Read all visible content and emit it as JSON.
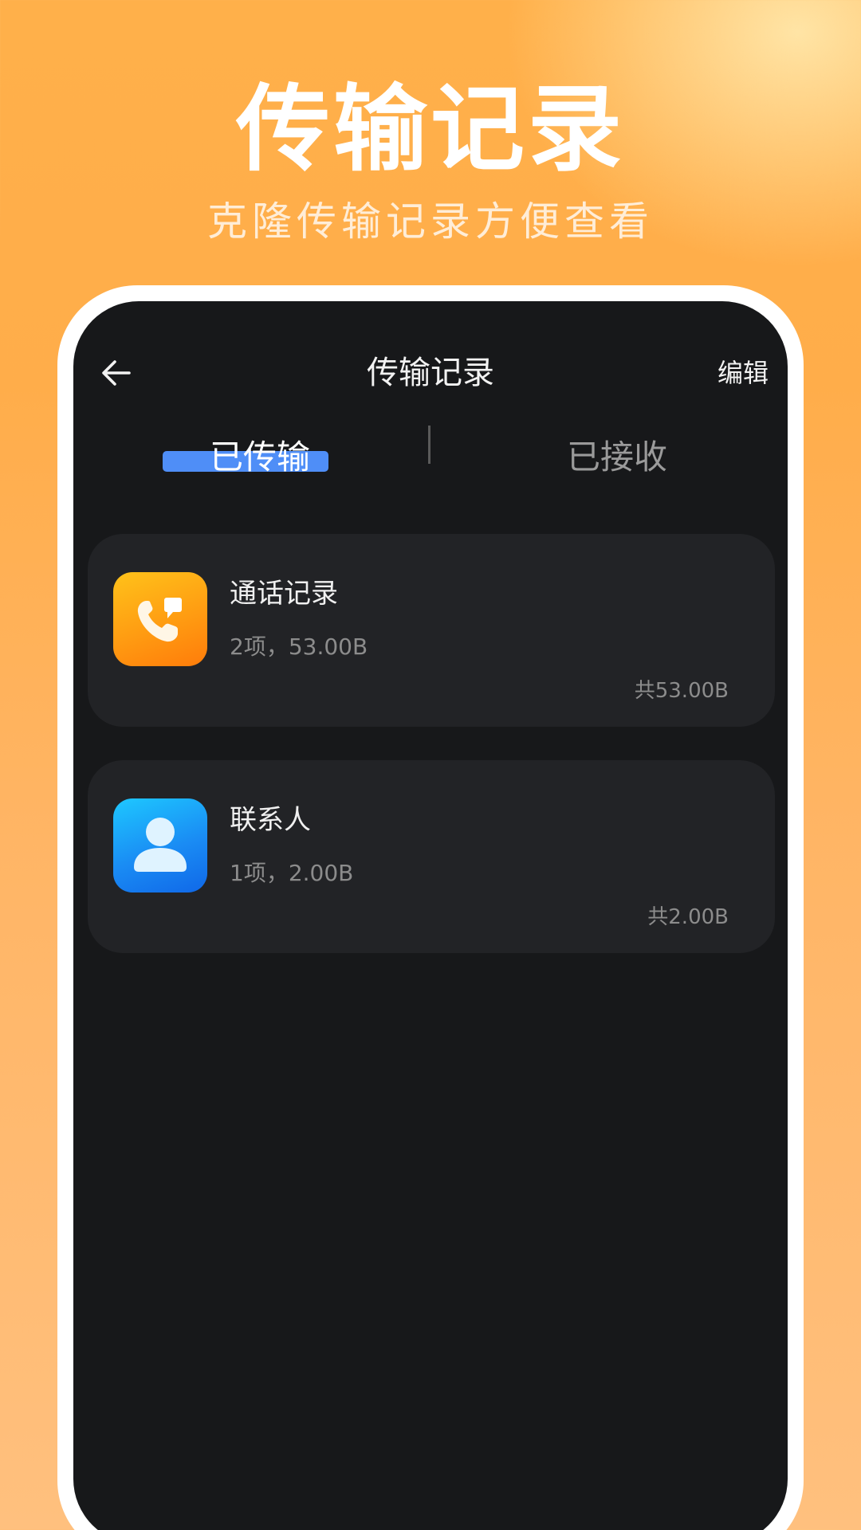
{
  "promo": {
    "title": "传输记录",
    "subtitle": "克隆传输记录方便查看"
  },
  "header": {
    "back_icon": "arrow-left-icon",
    "title": "传输记录",
    "edit_label": "编辑"
  },
  "tabs": [
    {
      "label": "已传输",
      "active": true
    },
    {
      "label": "已接收",
      "active": false
    }
  ],
  "accent_color": "#4f8ef7",
  "records": [
    {
      "icon": "phone-call-icon",
      "icon_colors": [
        "#ffc21a",
        "#ff7c0a"
      ],
      "name": "通话记录",
      "meta": "2项，53.00B",
      "total": "共53.00B"
    },
    {
      "icon": "contact-person-icon",
      "icon_colors": [
        "#1ec8ff",
        "#1068e8"
      ],
      "name": "联系人",
      "meta": "1项，2.00B",
      "total": "共2.00B"
    }
  ]
}
